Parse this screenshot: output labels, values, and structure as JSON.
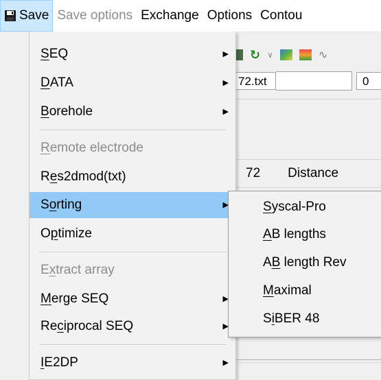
{
  "menubar": {
    "items": [
      {
        "label": "Save",
        "active": true
      },
      {
        "label": "Save options",
        "disabled": true
      },
      {
        "label": "Exchange"
      },
      {
        "label": "Options"
      },
      {
        "label": "Contou"
      }
    ]
  },
  "background": {
    "file_name": "72.txt",
    "zero_value": "0",
    "header_number": "72",
    "header_distance": "Distance"
  },
  "save_menu": {
    "items": [
      {
        "pre": "",
        "mn": "S",
        "post": "EQ",
        "submenu": true
      },
      {
        "pre": "",
        "mn": "D",
        "post": "ATA",
        "submenu": true
      },
      {
        "pre": "",
        "mn": "B",
        "post": "orehole",
        "submenu": true
      },
      {
        "pre": "",
        "mn": "R",
        "post": "emote electrode",
        "disabled": true
      },
      {
        "pre": "R",
        "mn": "e",
        "post": "s2dmod(txt)"
      },
      {
        "pre": "S",
        "mn": "o",
        "post": "rting",
        "submenu": true,
        "highlighted": true
      },
      {
        "pre": "O",
        "mn": "p",
        "post": "timize"
      },
      {
        "pre": "E",
        "mn": "x",
        "post": "tract array",
        "disabled": true
      },
      {
        "pre": "",
        "mn": "M",
        "post": "erge SEQ",
        "submenu": true
      },
      {
        "pre": "Re",
        "mn": "c",
        "post": "iprocal SEQ",
        "submenu": true
      },
      {
        "pre": "",
        "mn": "I",
        "post": "E2DP",
        "submenu": true
      }
    ]
  },
  "sorting_submenu": {
    "items": [
      {
        "pre": "",
        "mn": "S",
        "post": "yscal-Pro"
      },
      {
        "pre": "",
        "mn": "A",
        "post": "B lengths"
      },
      {
        "pre": "A",
        "mn": "B",
        "post": " length Rev"
      },
      {
        "pre": "",
        "mn": "M",
        "post": "aximal"
      },
      {
        "pre": "S",
        "mn": "i",
        "post": "BER 48"
      }
    ]
  },
  "icons": {
    "save": "floppy-disk-icon",
    "submenu_arrow": "triangle-right-icon",
    "refresh": "refresh-icon"
  },
  "colors": {
    "menu_highlight": "#91c9f7",
    "menubar_active": "#cce8ff",
    "disabled_text": "#8c8c8c"
  }
}
